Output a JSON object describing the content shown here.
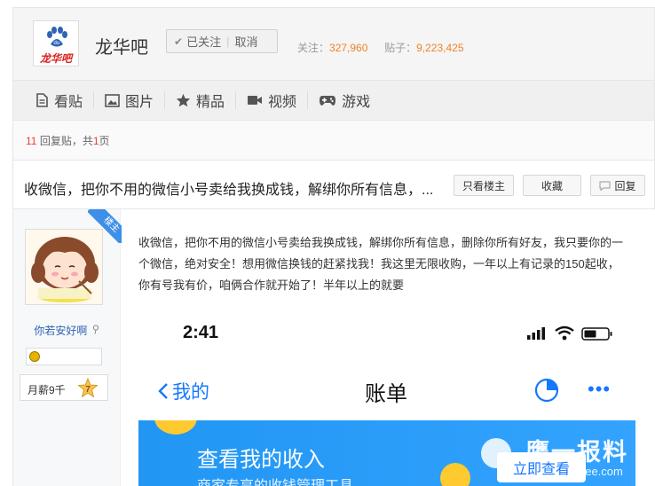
{
  "header": {
    "logo_text": "龙华吧",
    "bar_name": "龙华吧",
    "follow_status": "已关注",
    "unfollow_label": "取消",
    "followers_label": "关注：",
    "followers_count": "327,960",
    "posts_label": "贴子：",
    "posts_count": "9,223,425"
  },
  "nav": {
    "items": [
      {
        "label": "看贴",
        "icon": "document-icon"
      },
      {
        "label": "图片",
        "icon": "image-icon"
      },
      {
        "label": "精品",
        "icon": "star-icon"
      },
      {
        "label": "视频",
        "icon": "video-icon"
      },
      {
        "label": "游戏",
        "icon": "gamepad-icon"
      }
    ]
  },
  "reply_bar": {
    "reply_count": "11",
    "reply_label": "回复贴，共",
    "page_count": "1",
    "page_label": "页"
  },
  "post": {
    "title": "收微信，把你不用的微信小号卖给我换成钱，解绑你所有信息，...",
    "only_op_label": "只看楼主",
    "collect_label": "收藏",
    "reply_label": "回复",
    "body": "收微信，把你不用的微信小号卖给我换成钱，解绑你所有信息，删除你所有好友，我只要你的一个微信，绝对安全！想用微信换钱的赶紧找我！我这里无限收购，一年以上有记录的150起收，你有号我有价，咱俩合作就开始了！半年以上的就要"
  },
  "author": {
    "corner_label": "楼主",
    "name": "你若安好啊",
    "level_name": "月薪9千",
    "level_number": "7"
  },
  "phone": {
    "time": "2:41",
    "back_label": "我的",
    "title": "账单",
    "more": "•••",
    "banner_title": "查看我的收入",
    "banner_sub": "商家专享的收钱管理工具",
    "banner_button": "立即查看",
    "watermark": "鹰一报料",
    "watermark_sub": "eee.com"
  },
  "colors": {
    "accent_orange": "#f08228",
    "reply_red": "#e5432d",
    "link_blue": "#2d64b3",
    "alipay_blue": "#1677ff",
    "ribbon_blue": "#3d8fe8"
  }
}
